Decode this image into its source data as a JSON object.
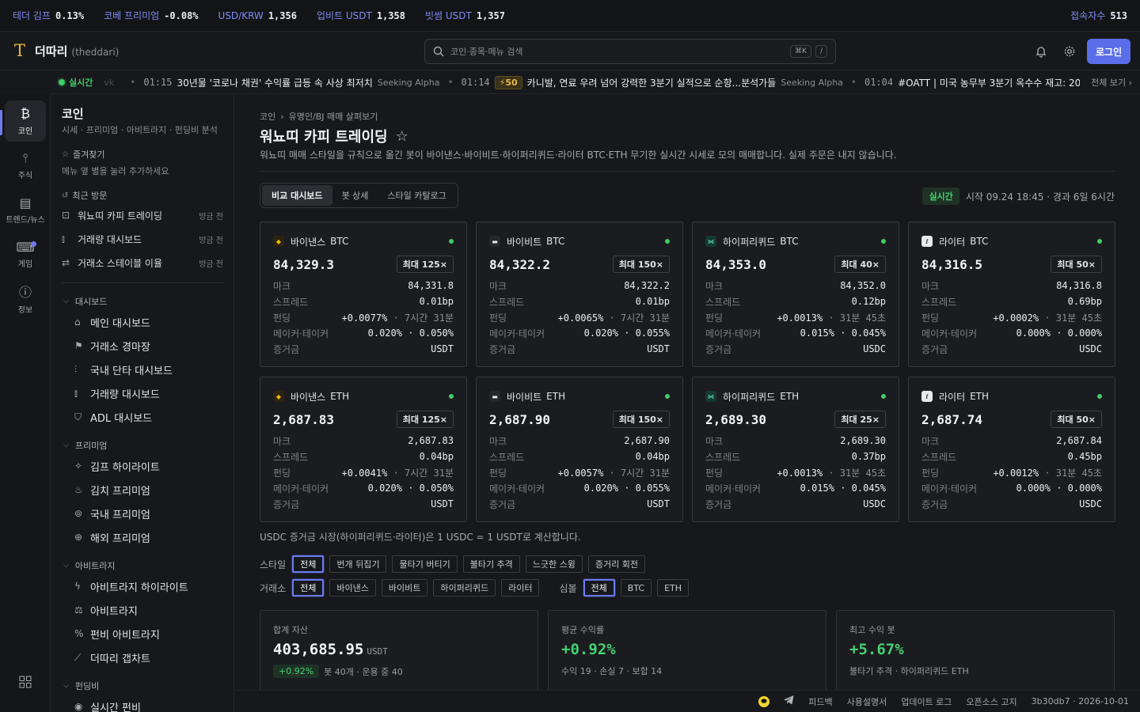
{
  "ticker": [
    {
      "label": "테더 김프",
      "value": "0.13%"
    },
    {
      "label": "코베 프리미엄",
      "value": "-0.08%"
    },
    {
      "label": "USD/KRW",
      "value": "1,356"
    },
    {
      "label": "업비트 USDT",
      "value": "1,358"
    },
    {
      "label": "빗썸 USDT",
      "value": "1,357"
    }
  ],
  "online": {
    "label": "접속자수",
    "value": "513"
  },
  "header": {
    "logo": "T",
    "brand": "더따리",
    "brand_sub": "(theddari)",
    "search_placeholder": "코인·종목·메뉴 검색",
    "kbd1": "⌘K",
    "kbd2": "/",
    "login": "로그인"
  },
  "news": {
    "live": "실시간",
    "faded": "vk",
    "items": [
      {
        "time": "01:15",
        "title": "30년물 '코로나 채권' 수익률 급등 속 사상 최저치",
        "source": "Seeking Alpha"
      },
      {
        "time": "01:14",
        "badge": "⚡50",
        "title": "카니발, 연료 우려 넘어 강력한 3분기 실적으로 순항...분석가들",
        "source": "Seeking Alpha"
      },
      {
        "time": "01:04",
        "title": "#OATT | 미국 농무부 3분기 옥수수 재고: 20억 부셸",
        "source": ""
      }
    ],
    "more": "전체 보기 ›"
  },
  "rail": [
    {
      "glyph": "₿",
      "label": "코인",
      "active": true
    },
    {
      "glyph": "⫯",
      "label": "주식"
    },
    {
      "glyph": "▤",
      "label": "트렌드/뉴스"
    },
    {
      "glyph": "⌨",
      "label": "게임"
    },
    {
      "glyph": "ⓘ",
      "label": "정보"
    }
  ],
  "sidebar": {
    "title": "코인",
    "subtitle": "시세 · 프리미엄 · 아비트라지 · 펀딩비 분석",
    "favorites": "즐겨찾기",
    "fav_hint": "메뉴 옆 별을 눌러 추가하세요",
    "recent": "최근 방문",
    "recent_items": [
      {
        "label": "워뇨띠 카피 트레이딩",
        "time": "방금 전"
      },
      {
        "label": "거래량 대시보드",
        "time": "방금 전"
      },
      {
        "label": "거래소 스테이블 이율",
        "time": "방금 전"
      }
    ],
    "groups": [
      {
        "label": "대시보드",
        "items": [
          "메인 대시보드",
          "거래소 경마장",
          "국내 단타 대시보드",
          "거래량 대시보드",
          "ADL 대시보드"
        ]
      },
      {
        "label": "프리미엄",
        "items": [
          "김프 하이라이트",
          "김치 프리미엄",
          "국내 프리미엄",
          "해외 프리미엄"
        ]
      },
      {
        "label": "아비트라지",
        "items": [
          "아비트라지 하이라이트",
          "아비트라지",
          "펀비 아비트라지",
          "더따리 갭차트"
        ]
      },
      {
        "label": "펀딩비",
        "items": [
          "실시간 펀비"
        ]
      }
    ]
  },
  "main": {
    "crumbs": [
      "코인",
      "유명인/BJ 매매 살펴보기"
    ],
    "title": "워뇨띠 카피 트레이딩",
    "desc": "워뇨띠 매매 스타일을 규칙으로 옮긴 봇이 바이낸스·바이비트·하이퍼리퀴드·라이터 BTC·ETH 무기한 실시간 시세로 모의 매매합니다. 실제 주문은 내지 않습니다.",
    "tabs": [
      "비교 대시보드",
      "봇 상세",
      "스타일 카탈로그"
    ],
    "status_pill": "실시간",
    "status_text": "시작 09.24 18:45 · 경과 6일 6시간",
    "row_keys": [
      "마크",
      "스프레드",
      "펀딩",
      "메이커·테이커",
      "증거금"
    ],
    "cards": [
      {
        "exchange": "바이낸스",
        "symbol": "BTC",
        "price": "84,329.3",
        "lev": "최대 125×",
        "mark": "84,331.8",
        "spread": "0.01bp",
        "funding": "+0.0077%",
        "funding_t": " · 7시간 31분",
        "fees": "0.020% · 0.050%",
        "margin": "USDT"
      },
      {
        "exchange": "바이비트",
        "symbol": "BTC",
        "price": "84,322.2",
        "lev": "최대 150×",
        "mark": "84,322.2",
        "spread": "0.01bp",
        "funding": "+0.0065%",
        "funding_t": " · 7시간 31분",
        "fees": "0.020% · 0.055%",
        "margin": "USDT"
      },
      {
        "exchange": "하이퍼리퀴드",
        "symbol": "BTC",
        "price": "84,353.0",
        "lev": "최대 40×",
        "mark": "84,352.0",
        "spread": "0.12bp",
        "funding": "+0.0013%",
        "funding_t": " · 31분 45초",
        "fees": "0.015% · 0.045%",
        "margin": "USDC"
      },
      {
        "exchange": "라이터",
        "symbol": "BTC",
        "price": "84,316.5",
        "lev": "최대 50×",
        "mark": "84,316.8",
        "spread": "0.69bp",
        "funding": "+0.0002%",
        "funding_t": " · 31분 45초",
        "fees": "0.000% · 0.000%",
        "margin": "USDC"
      },
      {
        "exchange": "바이낸스",
        "symbol": "ETH",
        "price": "2,687.83",
        "lev": "최대 125×",
        "mark": "2,687.83",
        "spread": "0.04bp",
        "funding": "+0.0041%",
        "funding_t": " · 7시간 31분",
        "fees": "0.020% · 0.050%",
        "margin": "USDT"
      },
      {
        "exchange": "바이비트",
        "symbol": "ETH",
        "price": "2,687.90",
        "lev": "최대 150×",
        "mark": "2,687.90",
        "spread": "0.04bp",
        "funding": "+0.0057%",
        "funding_t": " · 7시간 31분",
        "fees": "0.020% · 0.055%",
        "margin": "USDT"
      },
      {
        "exchange": "하이퍼리퀴드",
        "symbol": "ETH",
        "price": "2,689.30",
        "lev": "최대 25×",
        "mark": "2,689.30",
        "spread": "0.37bp",
        "funding": "+0.0013%",
        "funding_t": " · 31분 45초",
        "fees": "0.015% · 0.045%",
        "margin": "USDC"
      },
      {
        "exchange": "라이터",
        "symbol": "ETH",
        "price": "2,687.74",
        "lev": "최대 50×",
        "mark": "2,687.84",
        "spread": "0.45bp",
        "funding": "+0.0012%",
        "funding_t": " · 31분 45초",
        "fees": "0.000% · 0.000%",
        "margin": "USDC"
      }
    ],
    "note": "USDC 증거금 시장(하이퍼리퀴드·라이터)은 1 USDC = 1 USDT로 계산합니다.",
    "style_label": "스타일",
    "styles": [
      "전체",
      "번개 뒤집기",
      "물타기 버티기",
      "불타기 추격",
      "느긋한 스윙",
      "증거리 회전"
    ],
    "exchange_label": "거래소",
    "exchanges": [
      "전체",
      "바이낸스",
      "바이비트",
      "하이퍼리퀴드",
      "라이터"
    ],
    "symbol_label": "심볼",
    "symbols": [
      "전체",
      "BTC",
      "ETH"
    ],
    "summary": [
      {
        "k": "합계 자산",
        "v": "403,685.95",
        "unit": "USDT",
        "pill": "+0.92%",
        "sub": "봇 40개 · 운용 중 40"
      },
      {
        "k": "평균 수익률",
        "v": "+0.92%",
        "sub": "수익 19 · 손실 7 · 보합 14"
      },
      {
        "k": "최고 수익 봇",
        "v": "+5.67%",
        "sub": "불타기 추격 · 하이퍼리퀴드 ETH"
      }
    ]
  },
  "footer": [
    "피드백",
    "사용설명서",
    "업데이트 로그",
    "오픈소스 고지",
    "3b30db7 · 2026-10-01"
  ]
}
